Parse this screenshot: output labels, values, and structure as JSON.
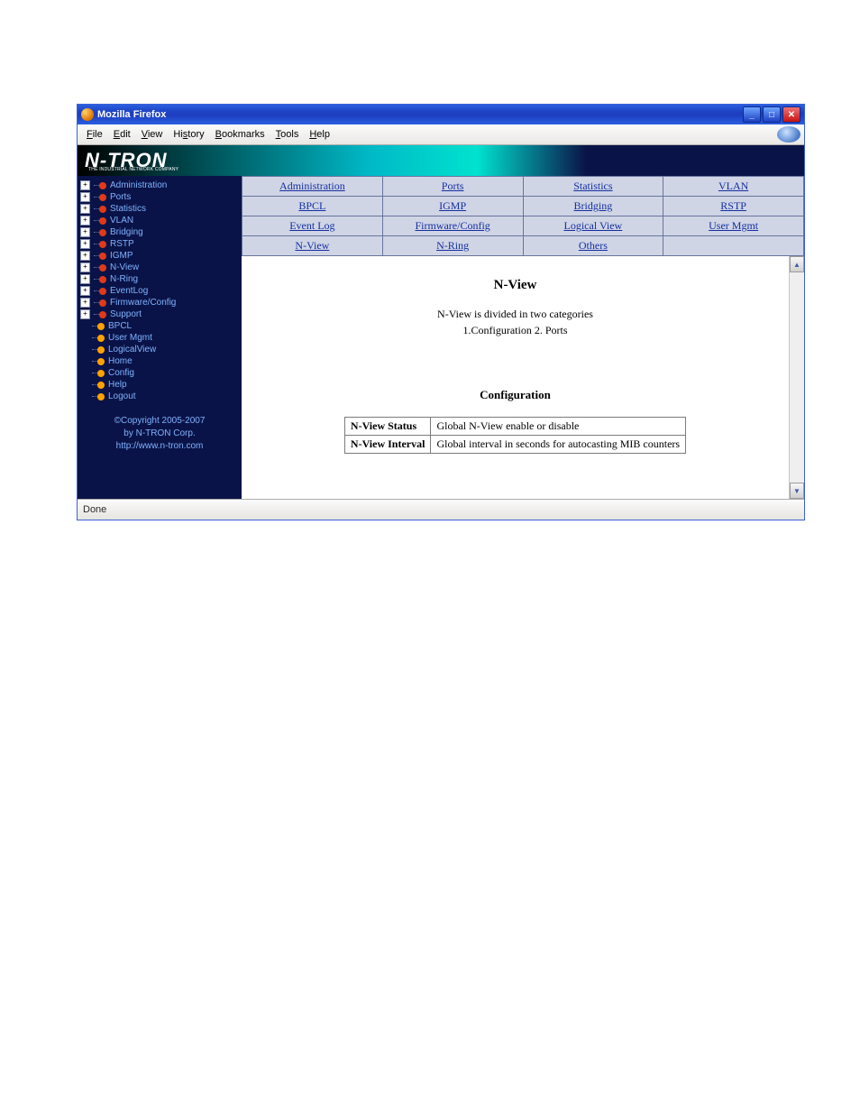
{
  "window": {
    "title": "Mozilla Firefox"
  },
  "menubar": {
    "file": "File",
    "edit": "Edit",
    "view": "View",
    "history": "History",
    "bookmarks": "Bookmarks",
    "tools": "Tools",
    "help": "Help"
  },
  "banner": {
    "logo": "N-TRON",
    "logo_sub": "THE INDUSTRIAL NETWORK COMPANY"
  },
  "sidebar": {
    "items": [
      {
        "label": "Administration",
        "bullet": "red",
        "expandable": true
      },
      {
        "label": "Ports",
        "bullet": "red",
        "expandable": true
      },
      {
        "label": "Statistics",
        "bullet": "red",
        "expandable": true
      },
      {
        "label": "VLAN",
        "bullet": "red",
        "expandable": true
      },
      {
        "label": "Bridging",
        "bullet": "red",
        "expandable": true
      },
      {
        "label": "RSTP",
        "bullet": "red",
        "expandable": true
      },
      {
        "label": "IGMP",
        "bullet": "red",
        "expandable": true
      },
      {
        "label": "N-View",
        "bullet": "red",
        "expandable": true
      },
      {
        "label": "N-Ring",
        "bullet": "red",
        "expandable": true
      },
      {
        "label": "EventLog",
        "bullet": "red",
        "expandable": true
      },
      {
        "label": "Firmware/Config",
        "bullet": "red",
        "expandable": true
      },
      {
        "label": "Support",
        "bullet": "red",
        "expandable": true
      },
      {
        "label": "BPCL",
        "bullet": "orange",
        "expandable": false
      },
      {
        "label": "User Mgmt",
        "bullet": "orange",
        "expandable": false
      },
      {
        "label": "LogicalView",
        "bullet": "orange",
        "expandable": false
      },
      {
        "label": "Home",
        "bullet": "orange",
        "expandable": false
      },
      {
        "label": "Config",
        "bullet": "orange",
        "expandable": false
      },
      {
        "label": "Help",
        "bullet": "orange",
        "expandable": false
      },
      {
        "label": "Logout",
        "bullet": "orange",
        "expandable": false
      }
    ],
    "copyright_line1": "©Copyright 2005-2007",
    "copyright_line2": "by N-TRON Corp.",
    "copyright_line3": "http://www.n-tron.com"
  },
  "topnav": {
    "rows": [
      [
        "Administration",
        "Ports",
        "Statistics",
        "VLAN"
      ],
      [
        "BPCL",
        "IGMP",
        "Bridging",
        "RSTP"
      ],
      [
        "Event Log",
        "Firmware/Config",
        "Logical View",
        "User Mgmt"
      ],
      [
        "N-View",
        "N-Ring",
        "Others",
        ""
      ]
    ]
  },
  "body": {
    "title": "N-View",
    "desc": "N-View is divided in two categories",
    "categs": "1.Configuration   2. Ports",
    "section": "Configuration",
    "rows": [
      {
        "k": "N-View Status",
        "v": "Global N-View enable or disable"
      },
      {
        "k": "N-View Interval",
        "v": "Global interval in seconds for autocasting MIB counters"
      }
    ]
  },
  "statusbar": {
    "text": "Done"
  }
}
